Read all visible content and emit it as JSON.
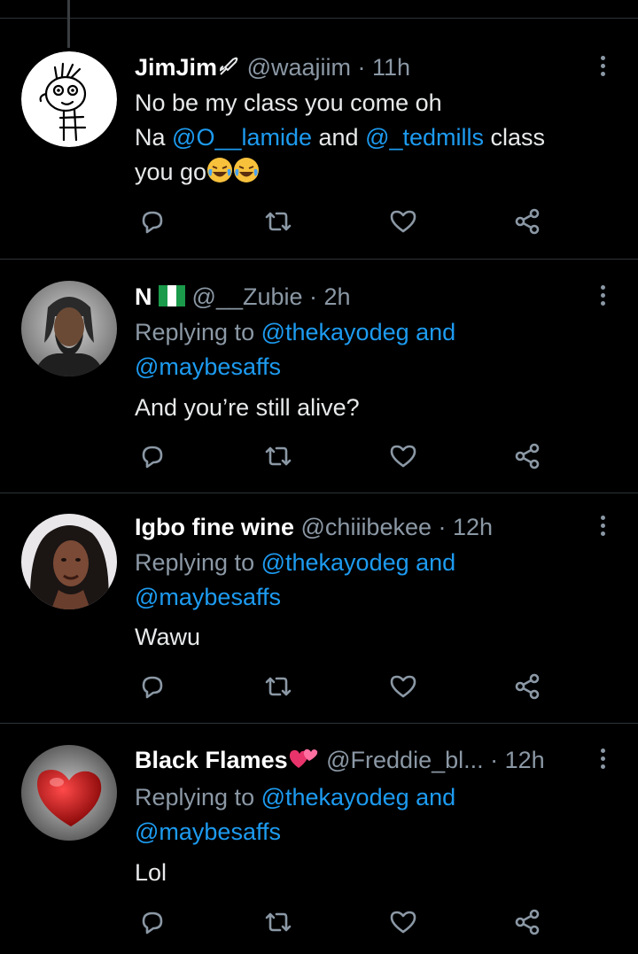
{
  "tweets": [
    {
      "name": "JimJim",
      "handle": "@waajiim",
      "time": "11h",
      "lines": [
        {
          "parts": [
            {
              "t": "No be my class you come oh"
            }
          ]
        },
        {
          "parts": [
            {
              "t": "Na "
            },
            {
              "t": "@O__lamide",
              "m": true
            },
            {
              "t": " and "
            },
            {
              "t": "@_tedmills",
              "m": true
            },
            {
              "t": " class"
            }
          ]
        },
        {
          "parts": [
            {
              "t": "you go"
            }
          ]
        }
      ]
    },
    {
      "name": "N",
      "handle": "@__Zubie",
      "time": "2h",
      "reply_prefix": "Replying to ",
      "reply_mention1": "@thekayodeg",
      "reply_and": " and",
      "reply_mention2": "@maybesaffs",
      "text": "And you’re still alive?"
    },
    {
      "name": "Igbo fine wine",
      "handle": "@chiiibekee",
      "time": "12h",
      "reply_prefix": "Replying to ",
      "reply_mention1": "@thekayodeg",
      "reply_and": " and",
      "reply_mention2": "@maybesaffs",
      "text": "Wawu"
    },
    {
      "name": "Black Flames",
      "handle": "@Freddie_bl...",
      "time": "12h",
      "reply_prefix": "Replying to ",
      "reply_mention1": "@thekayodeg",
      "reply_and": " and",
      "reply_mention2": "@maybesaffs",
      "text": "Lol"
    }
  ],
  "separator": " · ",
  "colors": {
    "accent": "#1d9bf0",
    "muted": "#8b98a5",
    "background": "#000000"
  },
  "icons": [
    "reply-icon",
    "retweet-icon",
    "like-icon",
    "share-icon",
    "more-options-icon"
  ]
}
